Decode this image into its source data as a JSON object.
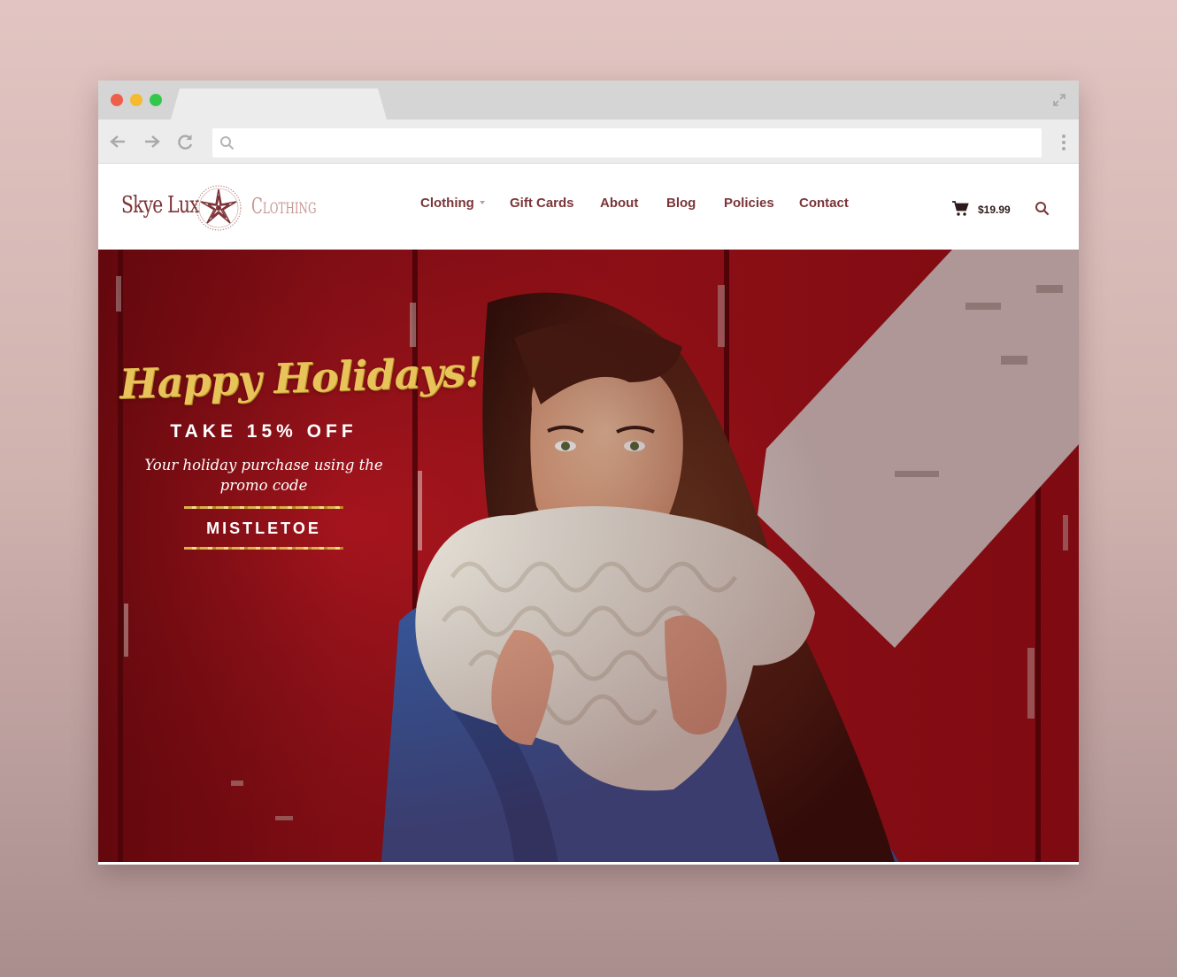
{
  "browser": {
    "url": "",
    "colors": {
      "close": "#ee5f4b",
      "minimize": "#f3bb2d",
      "maximize": "#34c84a"
    }
  },
  "site": {
    "logo": {
      "name": "Skye Lux",
      "tagline": "Clothing"
    },
    "nav": [
      {
        "label": "Clothing",
        "has_dropdown": true
      },
      {
        "label": "Gift Cards"
      },
      {
        "label": "About"
      },
      {
        "label": "Blog"
      },
      {
        "label": "Policies"
      },
      {
        "label": "Contact"
      }
    ],
    "cart_total": "$19.99",
    "colors": {
      "brand": "#7b3539",
      "gold": "#e7c35a",
      "hero_red": "#a8121b"
    }
  },
  "hero": {
    "headline": "Happy Holidays!",
    "offer": "TAKE 15% OFF",
    "subtext": "Your holiday purchase using the promo code",
    "promo_code": "MISTLETOE",
    "image": "woman-with-knit-scarf-photo"
  }
}
